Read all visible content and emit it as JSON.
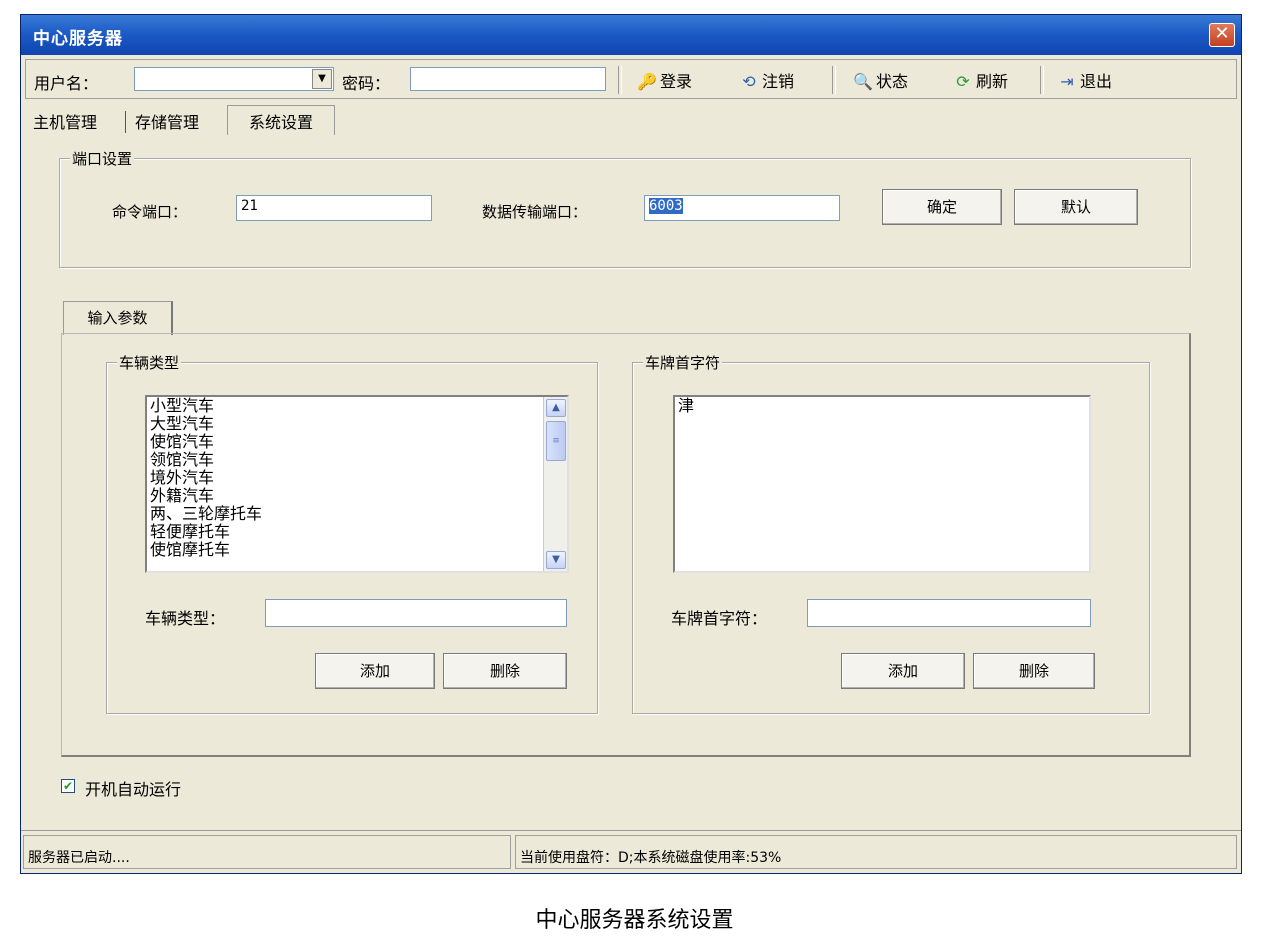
{
  "window": {
    "title": "中心服务器",
    "close_glyph": "✕"
  },
  "toolbar": {
    "username_label": "用户名：",
    "username_value": "",
    "password_label": "密码：",
    "password_value": "",
    "login_label": "登录",
    "logout_label": "注销",
    "status_label": "状态",
    "refresh_label": "刷新",
    "exit_label": "退出"
  },
  "tabs": [
    "主机管理",
    "存储管理",
    "系统设置"
  ],
  "port_settings": {
    "title": "端口设置",
    "command_port_label": "命令端口：",
    "command_port_value": "21",
    "data_port_label": "数据传输端口：",
    "data_port_value": "6003",
    "confirm_label": "确定",
    "default_label": "默认"
  },
  "input_params": {
    "tab_label": "输入参数",
    "vehicle_type": {
      "group_title": "车辆类型",
      "items": [
        "小型汽车",
        "大型汽车",
        "使馆汽车",
        "领馆汽车",
        "境外汽车",
        "外籍汽车",
        "两、三轮摩托车",
        "轻便摩托车",
        "使馆摩托车"
      ],
      "field_label": "车辆类型：",
      "field_value": "",
      "add_label": "添加",
      "delete_label": "删除"
    },
    "plate_prefix": {
      "group_title": "车牌首字符",
      "items": [
        "津"
      ],
      "field_label": "车牌首字符：",
      "field_value": "",
      "add_label": "添加",
      "delete_label": "删除"
    }
  },
  "autostart": {
    "label": "开机自动运行",
    "checked": true,
    "check_glyph": "✔"
  },
  "statusbar": {
    "left": "服务器已启动....",
    "right": "当前使用盘符：D;本系统磁盘使用率:53%"
  },
  "caption": "中心服务器系统设置",
  "icons": {
    "login": "🔑",
    "logout": "⟲",
    "status": "🔍",
    "refresh": "⟳",
    "exit": "⇥"
  }
}
